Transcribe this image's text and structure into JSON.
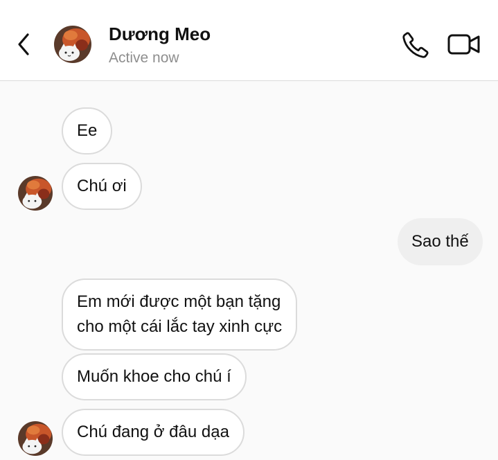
{
  "header": {
    "contact_name": "Dương Meo",
    "status": "Active now"
  },
  "messages": [
    {
      "from": "them",
      "text": "Ee"
    },
    {
      "from": "them",
      "text": "Chú ơi"
    },
    {
      "from": "me",
      "text": "Sao thế"
    },
    {
      "from": "them",
      "lines": [
        "Em mới được một bạn tặng",
        "cho một cái lắc tay xinh cực"
      ]
    },
    {
      "from": "them",
      "text": "Muốn khoe cho chú í"
    },
    {
      "from": "them",
      "text": "Chú đang ở đâu dạa"
    }
  ],
  "colors": {
    "header_bg": "#ffffff",
    "chat_bg": "#fafafa",
    "incoming_border": "#dbdbdb",
    "outgoing_bg": "#efefef",
    "status_text": "#8e8e8e"
  },
  "icons": [
    "chevron-left-icon",
    "phone-icon",
    "video-camera-icon"
  ]
}
